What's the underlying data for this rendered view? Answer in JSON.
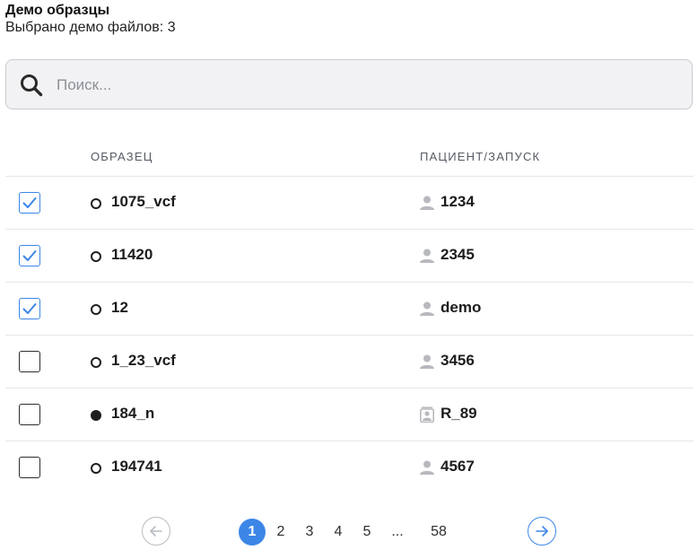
{
  "header": {
    "title": "Демо образцы",
    "subtitle": "Выбрано демо файлов: 3"
  },
  "search": {
    "placeholder": "Поиск...",
    "value": ""
  },
  "table": {
    "columns": {
      "sample": "ОБРАЗЕЦ",
      "patient": "ПАЦИЕНТ/ЗАПУСК"
    },
    "rows": [
      {
        "checked": true,
        "dot": "empty",
        "sample": "1075_vcf",
        "patient_icon": "person-icon",
        "patient": "1234"
      },
      {
        "checked": true,
        "dot": "empty",
        "sample": "11420",
        "patient_icon": "person-icon",
        "patient": "2345"
      },
      {
        "checked": true,
        "dot": "empty",
        "sample": "12",
        "patient_icon": "person-icon",
        "patient": "demo"
      },
      {
        "checked": false,
        "dot": "empty",
        "sample": "1_23_vcf",
        "patient_icon": "person-icon",
        "patient": "3456"
      },
      {
        "checked": false,
        "dot": "filled",
        "sample": "184_n",
        "patient_icon": "run-icon",
        "patient": "R_89"
      },
      {
        "checked": false,
        "dot": "empty",
        "sample": "194741",
        "patient_icon": "person-icon",
        "patient": "4567"
      }
    ]
  },
  "pagination": {
    "pages": [
      "1",
      "2",
      "3",
      "4",
      "5",
      "...",
      "58"
    ],
    "active": "1"
  },
  "colors": {
    "accent": "#3c86e8",
    "border": "#c9cbd0",
    "muted_icon": "#b7b9be"
  }
}
